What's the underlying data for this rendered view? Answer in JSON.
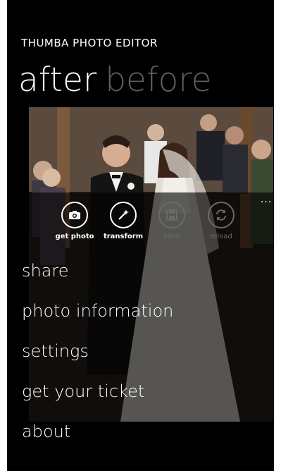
{
  "app": {
    "title": "THUMBA PHOTO EDITOR"
  },
  "pivot": {
    "items": [
      {
        "label": "after",
        "active": true
      },
      {
        "label": "before",
        "active": false
      }
    ]
  },
  "appbar": {
    "buttons": [
      {
        "label": "get photo",
        "icon": "camera-icon",
        "enabled": true
      },
      {
        "label": "transform",
        "icon": "magic-wand-icon",
        "enabled": true
      },
      {
        "label": "save",
        "icon": "floppy-disk-icon",
        "enabled": false
      },
      {
        "label": "reload",
        "icon": "refresh-icon",
        "enabled": false
      }
    ],
    "more": "..."
  },
  "menu": {
    "items": [
      {
        "label": "share"
      },
      {
        "label": "photo information"
      },
      {
        "label": "settings"
      },
      {
        "label": "get your ticket"
      },
      {
        "label": "about"
      }
    ]
  },
  "colors": {
    "background": "#000000",
    "text": "#ffffff",
    "inactive": "#5e5e5e",
    "disabled": "#6a6a6a"
  }
}
